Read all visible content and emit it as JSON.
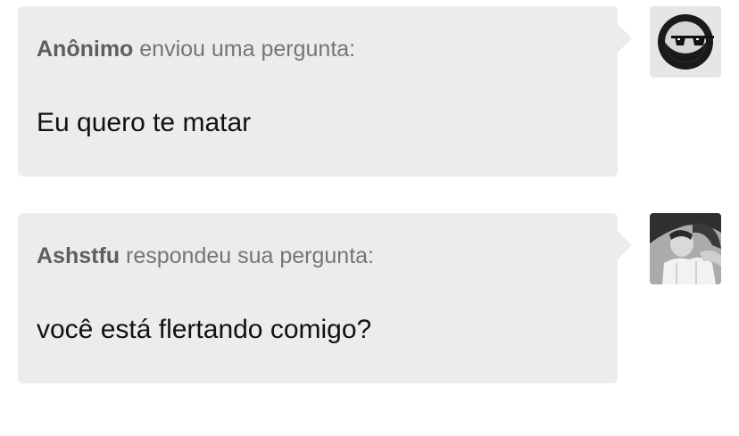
{
  "conversation": [
    {
      "sender": "Anônimo",
      "action": "enviou uma pergunta:",
      "text": "Eu quero te matar",
      "avatar_icon": "sunglasses-moon-avatar-icon"
    },
    {
      "sender": "Ashstfu",
      "action": "respondeu sua pergunta:",
      "text": "você está flertando comigo?",
      "avatar_icon": "user-photo-avatar"
    }
  ],
  "colors": {
    "bubble_bg": "#ececec",
    "sender_text": "#5e5e5e",
    "action_text": "#757575",
    "message_text": "#111111"
  }
}
